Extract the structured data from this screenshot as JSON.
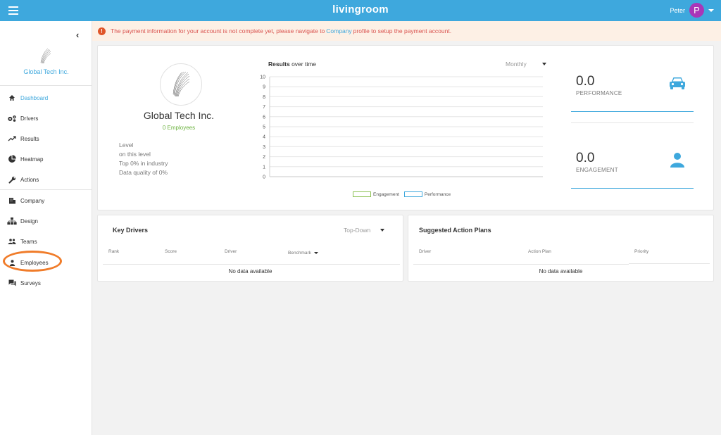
{
  "app": {
    "brand": "livingroom",
    "user_name": "Peter",
    "user_initial": "P",
    "accent": "#3ea8dd",
    "avatar_color": "#a936b8"
  },
  "sidebar": {
    "org_name": "Global Tech Inc.",
    "items": [
      {
        "label": "Dashboard",
        "icon": "home-icon",
        "active": true
      },
      {
        "label": "Drivers",
        "icon": "gears-icon"
      },
      {
        "label": "Results",
        "icon": "trending-up-icon"
      },
      {
        "label": "Heatmap",
        "icon": "pie-chart-icon"
      },
      {
        "label": "Actions",
        "icon": "wrench-icon"
      },
      {
        "label": "Company",
        "icon": "building-icon"
      },
      {
        "label": "Design",
        "icon": "sitemap-icon"
      },
      {
        "label": "Teams",
        "icon": "people-icon"
      },
      {
        "label": "Employees",
        "icon": "person-icon",
        "highlighted": true
      },
      {
        "label": "Surveys",
        "icon": "chat-icon"
      }
    ]
  },
  "alert": {
    "text_before": "The payment information for your account is not complete yet, please navigate to",
    "link": "Company",
    "text_after": "profile to setup the payment account."
  },
  "summary": {
    "company_name": "Global Tech Inc.",
    "employees": "0 Employees",
    "stats": [
      "Level",
      "on this level",
      "Top 0% in industry",
      "Data quality of 0%"
    ]
  },
  "chart": {
    "title_bold": "Results",
    "title_rest": " over time",
    "period": "Monthly",
    "legend": [
      "Engagement",
      "Performance"
    ]
  },
  "chart_data": {
    "type": "line",
    "title": "Results over time",
    "x": [],
    "series": [
      {
        "name": "Engagement",
        "values": []
      },
      {
        "name": "Performance",
        "values": []
      }
    ],
    "ylim": [
      0,
      10
    ],
    "yticks": [
      0,
      1,
      2,
      3,
      4,
      5,
      6,
      7,
      8,
      9,
      10
    ],
    "grid": true,
    "legend": "bottom",
    "colors": {
      "Engagement": "#8cc152",
      "Performance": "#3ea8dd"
    }
  },
  "kpis": [
    {
      "value": "0.0",
      "label": "PERFORMANCE",
      "icon": "car-icon"
    },
    {
      "value": "0.0",
      "label": "ENGAGEMENT",
      "icon": "person-icon"
    }
  ],
  "key_drivers": {
    "title": "Key Drivers",
    "mode": "Top-Down",
    "columns": [
      "Rank",
      "Score",
      "Driver",
      "Benchmark"
    ],
    "empty": "No data available"
  },
  "action_plans": {
    "title": "Suggested Action Plans",
    "columns": [
      "Driver",
      "Action Plan",
      "Priority"
    ],
    "empty": "No data available"
  }
}
